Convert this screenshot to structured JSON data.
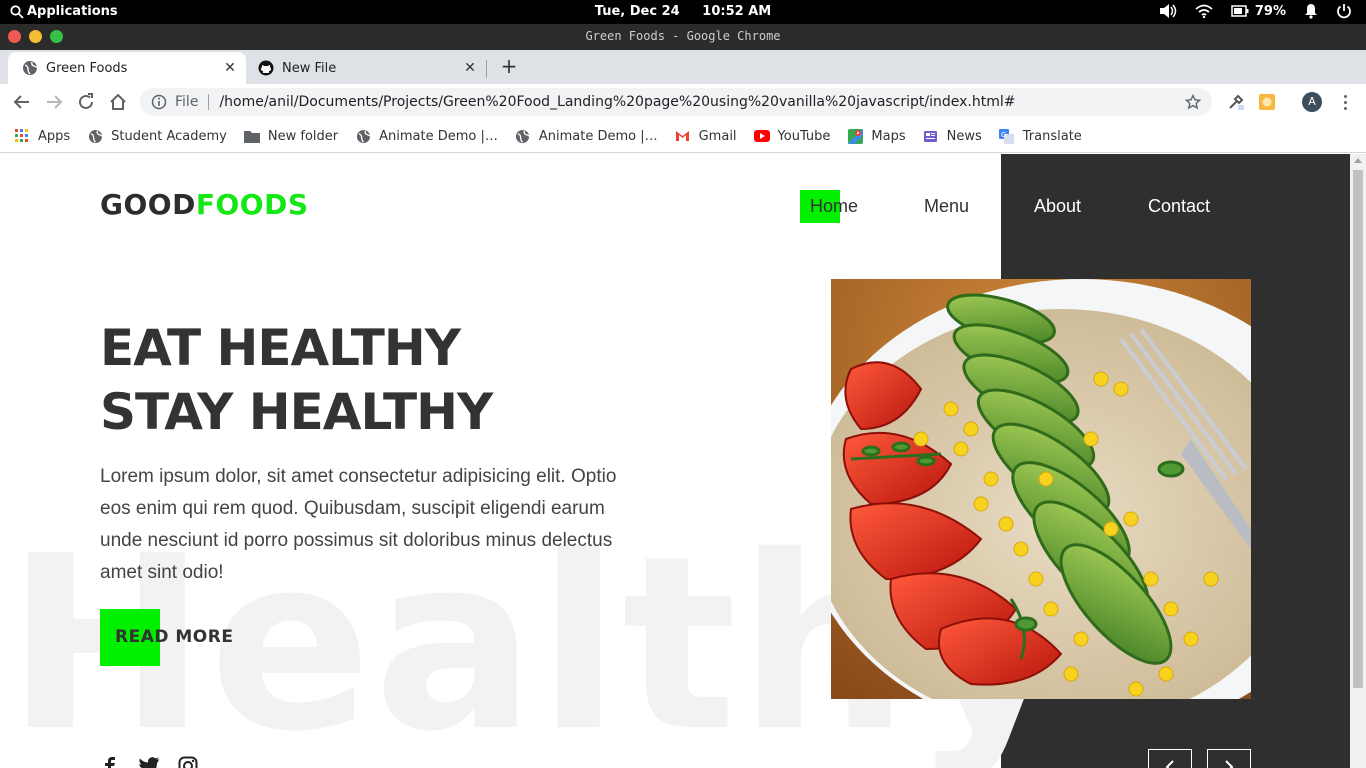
{
  "system": {
    "apps_label": "Applications",
    "clock": "Tue, Dec 24     10:52 AM",
    "battery": "79%"
  },
  "window": {
    "title": "Green Foods - Google Chrome"
  },
  "tabs": [
    {
      "label": "Green Foods",
      "close": "✕"
    },
    {
      "label": "New File",
      "close": "✕"
    }
  ],
  "new_tab": "+",
  "omnibox": {
    "scheme_label": "File",
    "url": "/home/anil/Documents/Projects/Green%20Food_Landing%20page%20using%20vanilla%20javascript/index.html#"
  },
  "profile": {
    "initial": "A"
  },
  "bookmarks": [
    {
      "label": "Apps",
      "icon": "apps-grid-icon"
    },
    {
      "label": "Student Academy",
      "icon": "globe-icon"
    },
    {
      "label": "New folder",
      "icon": "folder-icon"
    },
    {
      "label": "Animate Demo |…",
      "icon": "globe-icon"
    },
    {
      "label": "Animate Demo |…",
      "icon": "globe-icon"
    },
    {
      "label": "Gmail",
      "icon": "gmail-icon"
    },
    {
      "label": "YouTube",
      "icon": "youtube-icon"
    },
    {
      "label": "Maps",
      "icon": "maps-icon"
    },
    {
      "label": "News",
      "icon": "news-icon"
    },
    {
      "label": "Translate",
      "icon": "translate-icon"
    }
  ],
  "site": {
    "logo_part1": "GOOD",
    "logo_part2": "FOODS",
    "nav": {
      "home": "Home",
      "menu": "Menu",
      "about": "About",
      "contact": "Contact"
    },
    "headline_line1": "EAT HEALTHY",
    "headline_line2": "STAY HEALTHY",
    "paragraph": "Lorem ipsum dolor, sit amet consectetur adipisicing elit. Optio eos enim qui rem quod. Quibusdam, suscipit eligendi earum unde nesciunt id porro possimus sit doloribus minus delectus amet sint odio!",
    "read_more": "READ MORE",
    "background_word": "Healthy",
    "colors": {
      "accent": "#00f000",
      "logo_green": "#14e814",
      "dark_panel": "#2f2f2f",
      "text_dark": "#333333"
    },
    "socials": [
      "facebook-icon",
      "twitter-icon",
      "instagram-icon"
    ]
  }
}
